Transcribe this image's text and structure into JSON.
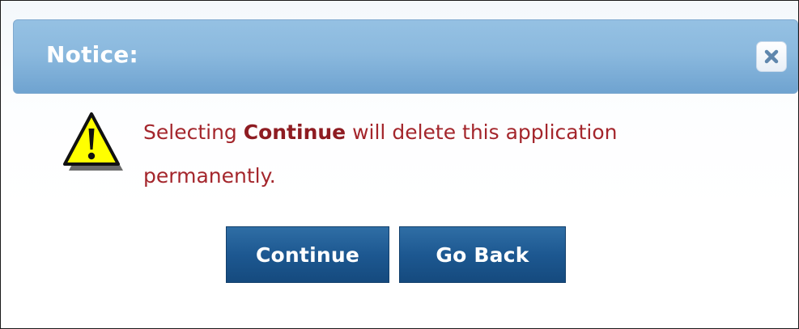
{
  "dialog": {
    "title": "Notice:",
    "close_icon": "close-icon",
    "warning_icon": "warning-icon",
    "message_prefix": "Selecting ",
    "message_emphasis": "Continue",
    "message_suffix": " will delete this application permanently.",
    "buttons": {
      "continue_label": "Continue",
      "go_back_label": "Go Back"
    }
  },
  "colors": {
    "titlebar": "#8bb9de",
    "message_text": "#a4262c",
    "button": "#1d5891",
    "warning_fill": "#ffff00"
  }
}
